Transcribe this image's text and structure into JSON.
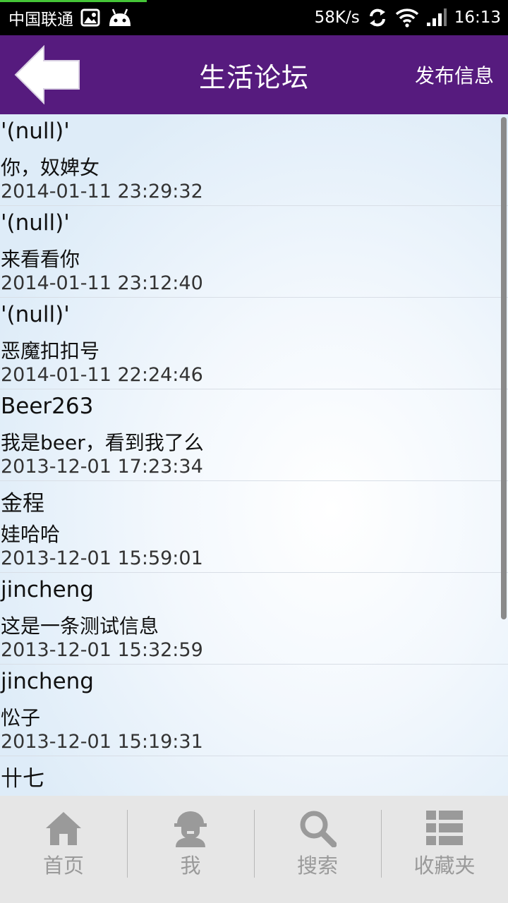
{
  "status_bar": {
    "carrier": "中国联通",
    "speed": "58K/s",
    "time": "16:13"
  },
  "header": {
    "title": "生活论坛",
    "publish_label": "发布信息",
    "background_color": "#561b7e"
  },
  "posts": [
    {
      "author": "'(null)'",
      "content": "你，奴婢女",
      "time": "2014-01-11 23:29:32"
    },
    {
      "author": "'(null)'",
      "content": "来看看你",
      "time": "2014-01-11 23:12:40"
    },
    {
      "author": "'(null)'",
      "content": "恶魔扣扣号",
      "time": "2014-01-11 22:24:46"
    },
    {
      "author": "Beer263",
      "content": "我是beer，看到我了么",
      "time": "2013-12-01 17:23:34"
    },
    {
      "author": "金程",
      "content": "娃哈哈",
      "time": "2013-12-01 15:59:01"
    },
    {
      "author": "jincheng",
      "content": "这是一条测试信息",
      "time": "2013-12-01 15:32:59"
    },
    {
      "author": "jincheng",
      "content": "忪子",
      "time": "2013-12-01 15:19:31"
    },
    {
      "author": "卄七",
      "content": "",
      "time": ""
    }
  ],
  "bottom_nav": [
    {
      "label": "首页",
      "icon": "home-icon"
    },
    {
      "label": "我",
      "icon": "user-icon"
    },
    {
      "label": "搜索",
      "icon": "search-icon"
    },
    {
      "label": "收藏夹",
      "icon": "favorites-list-icon"
    }
  ]
}
